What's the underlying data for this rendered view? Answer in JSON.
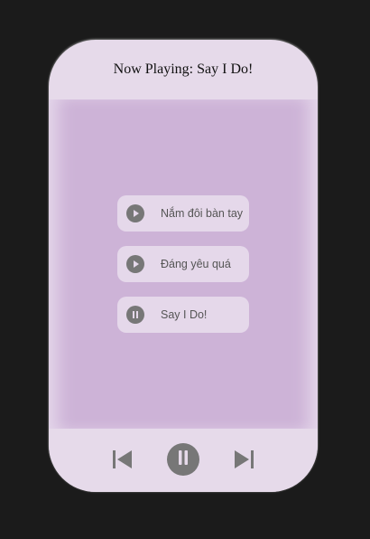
{
  "header": {
    "label": "Now Playing:",
    "current_track": "Say I Do!"
  },
  "playlist": [
    {
      "title": "Nắm đôi bàn tay",
      "state": "play-icon"
    },
    {
      "title": "Đáng yêu quá",
      "state": "play-icon"
    },
    {
      "title": "Say I Do!",
      "state": "pause-icon"
    }
  ],
  "controls": {
    "previous": "skip-previous-icon",
    "play_pause": "pause-icon",
    "next": "skip-next-icon"
  },
  "colors": {
    "background": "#1b1b1b",
    "player": "#e6daea",
    "playlist_area": "#cdb3d7",
    "track_item": "#e5d8ea",
    "icon": "#777777"
  }
}
